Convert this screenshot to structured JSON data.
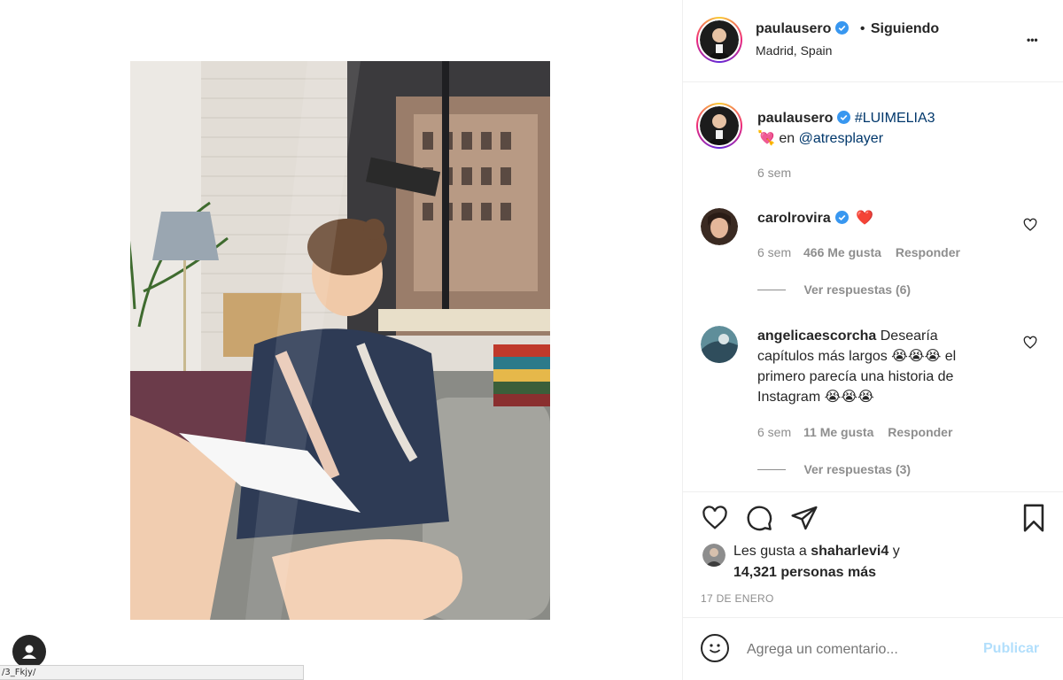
{
  "header": {
    "username": "paulausero",
    "follow_separator": "•",
    "follow_status": "Siguiendo",
    "location": "Madrid, Spain",
    "more_label": "•••"
  },
  "caption": {
    "username": "paulausero",
    "hashtag": "#LUIMELIA3",
    "emoji": "💘",
    "text_prefix": "en",
    "mention": "@atresplayer",
    "time": "6 sem"
  },
  "comments": [
    {
      "username": "carolrovira",
      "verified": true,
      "text": "❤️",
      "time": "6 sem",
      "likes": "466 Me gusta",
      "reply": "Responder",
      "view_replies": "Ver respuestas (6)"
    },
    {
      "username": "angelicaescorcha",
      "verified": false,
      "text_line1": "Desearía",
      "text_line2": "capítulos más largos 😭😭😭 el",
      "text_line3": "primero parecía una historia de",
      "text_line4": "Instagram 😭😭😭",
      "time": "6 sem",
      "likes": "11 Me gusta",
      "reply": "Responder",
      "view_replies": "Ver respuestas (3)"
    }
  ],
  "likes": {
    "prefix": "Les gusta a",
    "user": "shaharlevi4",
    "joiner": "y",
    "count": "14,321 personas más"
  },
  "date": "17 DE ENERO",
  "comment_box": {
    "placeholder": "Agrega un comentario...",
    "publish": "Publicar",
    "emoji_icon": "☺"
  },
  "status_bar": {
    "url": "/3_Fkjy/"
  },
  "colors": {
    "verified": "#3897f0",
    "link": "#00376b",
    "publish_disabled": "#b2dffc",
    "heart": "#ed4956"
  }
}
